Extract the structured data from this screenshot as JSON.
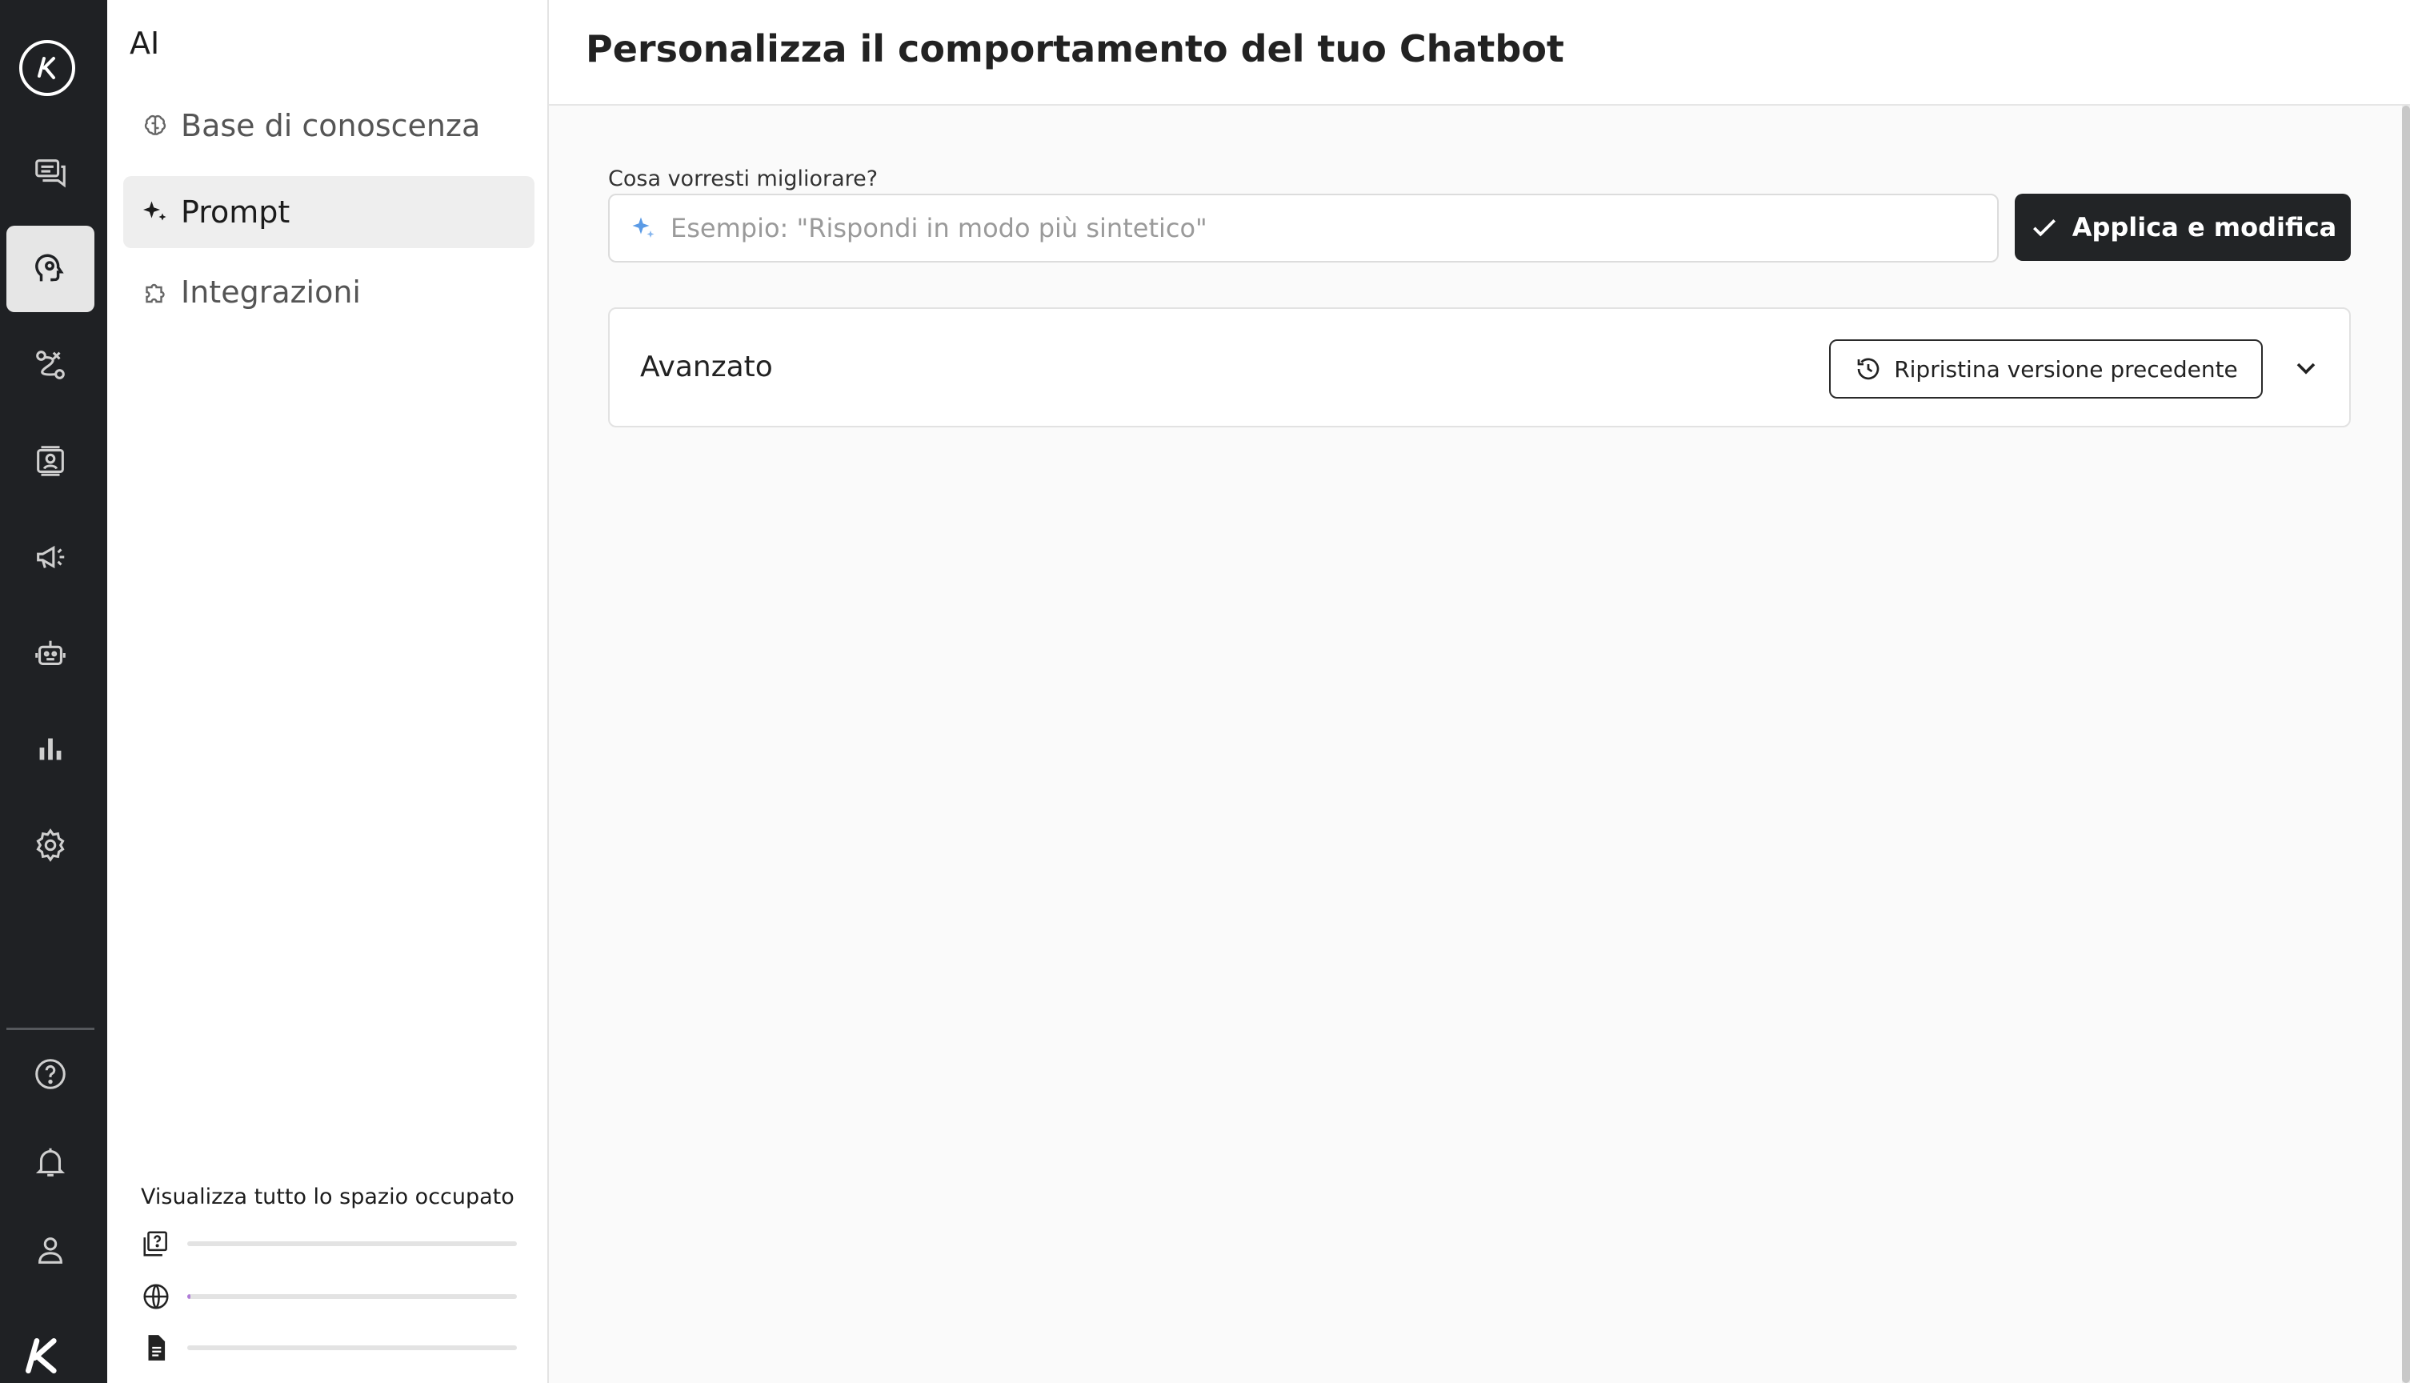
{
  "rail": {
    "logo_icon": "brand-logo-icon",
    "items": [
      {
        "icon": "chat-icon",
        "active": false
      },
      {
        "icon": "ai-head-icon",
        "active": true
      },
      {
        "icon": "flows-icon",
        "active": false
      },
      {
        "icon": "contacts-icon",
        "active": false
      },
      {
        "icon": "megaphone-icon",
        "active": false
      },
      {
        "icon": "robot-icon",
        "active": false
      },
      {
        "icon": "bar-chart-icon",
        "active": false
      },
      {
        "icon": "gear-icon",
        "active": false
      }
    ],
    "bottom_items": [
      {
        "icon": "help-icon"
      },
      {
        "icon": "bell-icon"
      },
      {
        "icon": "user-icon"
      }
    ],
    "accent_active_bg": "#e6e6e6",
    "rail_bg": "#1f2124"
  },
  "sidebar": {
    "title": "AI",
    "items": [
      {
        "label": "Base di conoscenza",
        "icon": "brain-icon",
        "active": false
      },
      {
        "label": "Prompt",
        "icon": "sparkle-icon",
        "active": true
      },
      {
        "label": "Integrazioni",
        "icon": "puzzle-icon",
        "active": false
      }
    ],
    "usage": {
      "title": "Visualizza tutto lo spazio occupato",
      "rows": [
        {
          "icon": "faq-icon",
          "fill": 0
        },
        {
          "icon": "globe-icon",
          "fill": 0.01
        },
        {
          "icon": "document-icon",
          "fill": 0
        }
      ],
      "fill_color": "#b07cd8"
    }
  },
  "main": {
    "title": "Personalizza il comportamento del tuo Chatbot",
    "field_label": "Cosa vorresti migliorare?",
    "input_placeholder": "Esempio: \"Rispondi in modo più sintetico\"",
    "input_value": "",
    "apply_button": "Applica e modifica",
    "advanced": {
      "title": "Avanzato",
      "restore_button": "Ripristina versione precedente"
    }
  }
}
